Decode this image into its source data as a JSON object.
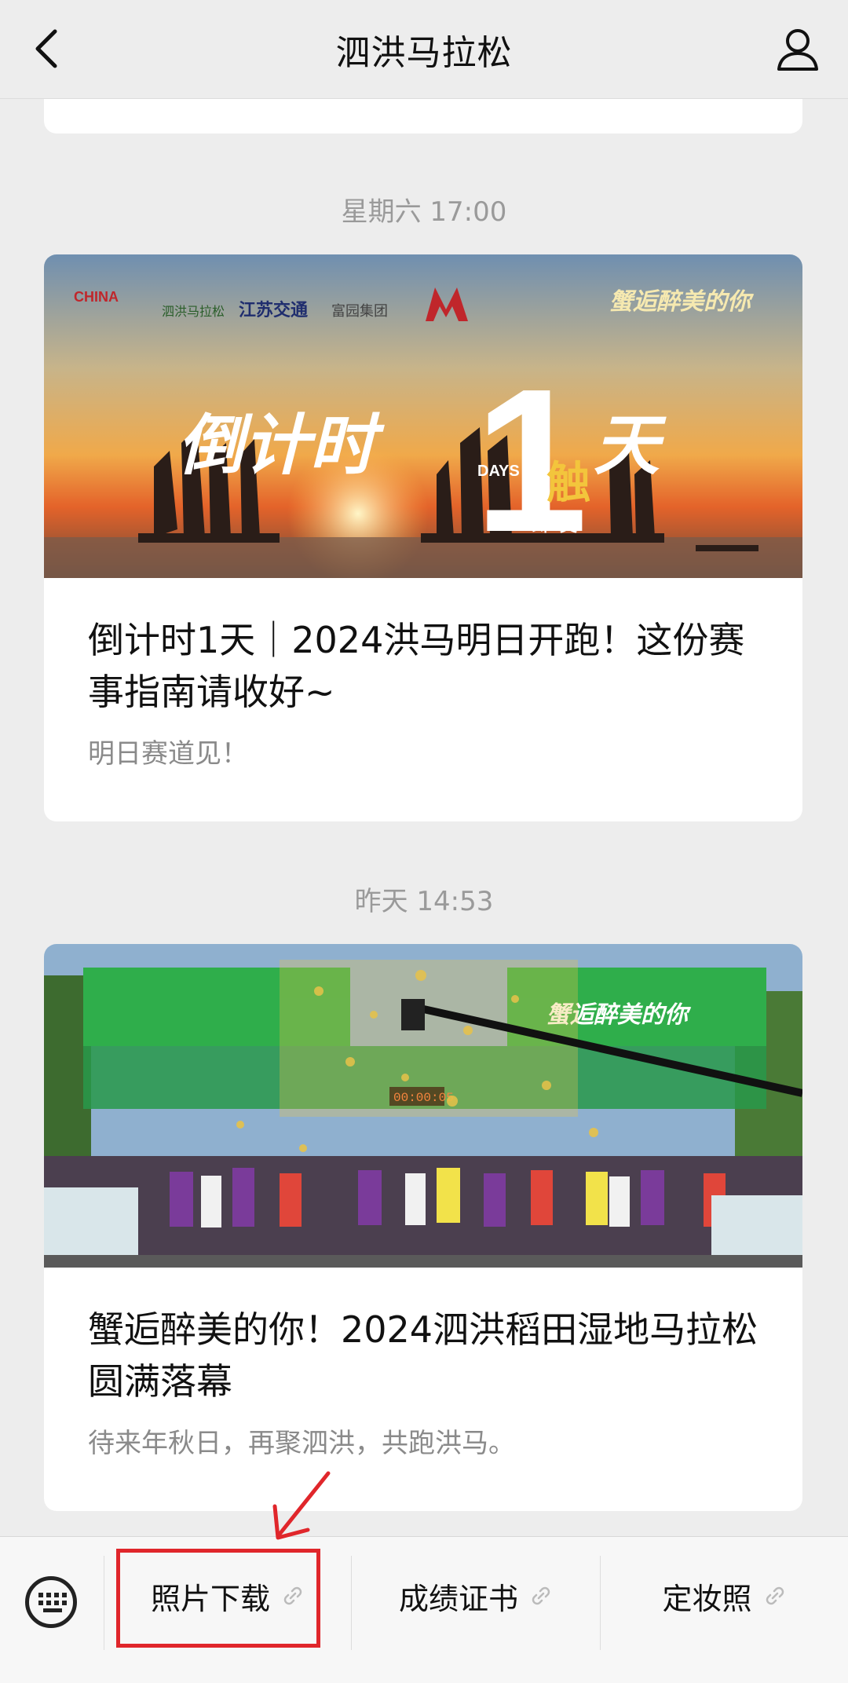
{
  "header": {
    "title": "泗洪马拉松"
  },
  "posts": [
    {
      "timestamp": "星期六 17:00",
      "cover": {
        "countdown_text": "倒计时",
        "big_number": "1",
        "days_label": "DAYS",
        "day_char": "天",
        "touch_char": "触",
        "launch_text": "即发",
        "slogan": "蟹逅醉美的你",
        "sponsor_logos": [
          "CHINA",
          "泗洪马拉松",
          "江苏交通",
          "富园集团"
        ]
      },
      "title": "倒计时1天｜2024洪马明日开跑！这份赛事指南请收好~",
      "summary": "明日赛道见！"
    },
    {
      "timestamp": "昨天 14:53",
      "cover": {
        "banner_text_right": "蟹逅醉美的你",
        "clock": "00:00:05"
      },
      "title": "蟹逅醉美的你！2024泗洪稻田湿地马拉松圆满落幕",
      "summary": "待来年秋日，再聚泗洪，共跑洪马。"
    }
  ],
  "menu": {
    "items": [
      {
        "label": "照片下载"
      },
      {
        "label": "成绩证书"
      },
      {
        "label": "定妆照"
      }
    ]
  },
  "colors": {
    "highlight": "#e0262b",
    "background": "#ededed"
  }
}
